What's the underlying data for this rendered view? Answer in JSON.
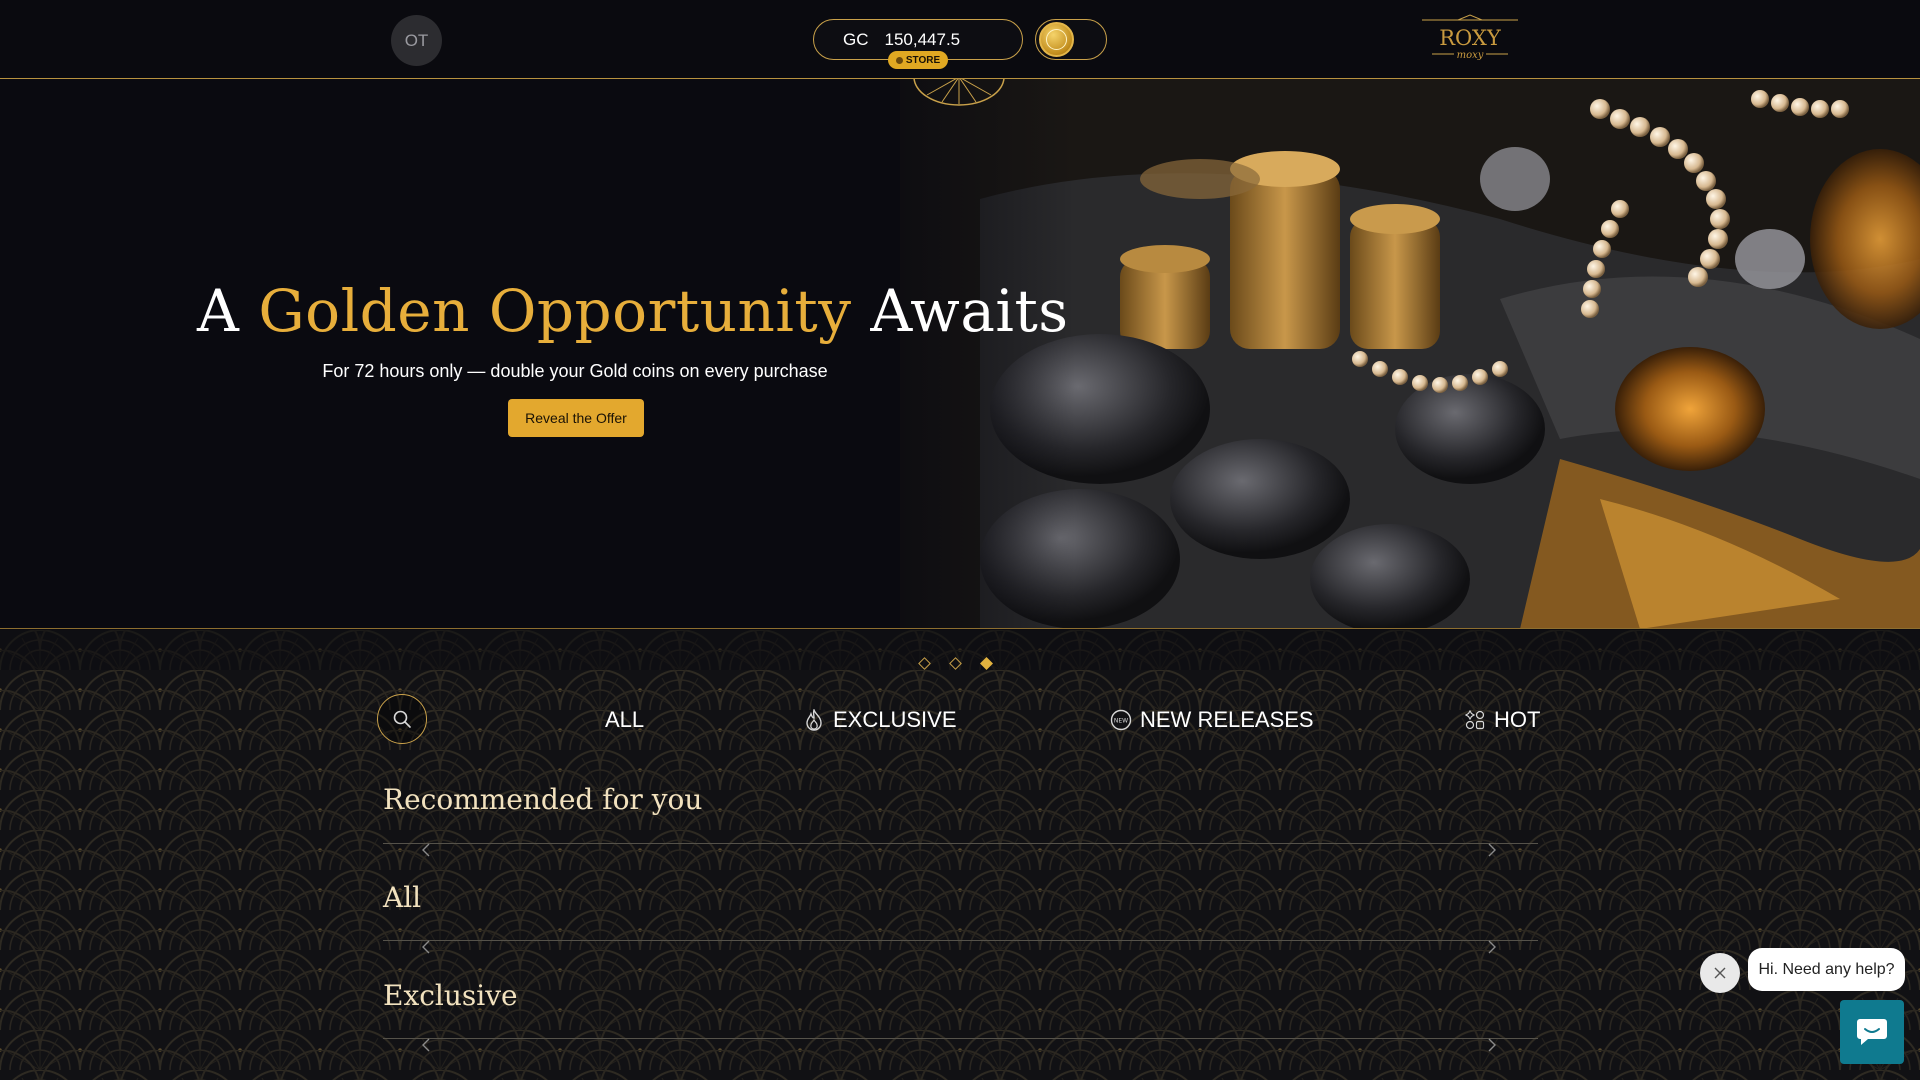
{
  "header": {
    "avatar_initials": "OT",
    "balance": {
      "currency": "GC",
      "amount": "150,447.5"
    },
    "store_label": "STORE",
    "logo": {
      "name": "ROXY",
      "tagline": "moxy"
    }
  },
  "hero": {
    "title_plain_1": "A",
    "title_gold": "Golden Opportunity",
    "title_plain_2": "Awaits",
    "subtitle": "For 72 hours only — double your Gold coins on every purchase",
    "cta_label": "Reveal the Offer"
  },
  "carousel": {
    "slides": 3,
    "active_index": 2
  },
  "tabs": [
    {
      "label": "ALL",
      "icon": "none"
    },
    {
      "label": "EXCLUSIVE",
      "icon": "flame-icon"
    },
    {
      "label": "NEW RELEASES",
      "icon": "new-badge-icon"
    },
    {
      "label": "HOT",
      "icon": "grid-sparkle-icon"
    }
  ],
  "sections": [
    {
      "title": "Recommended for you"
    },
    {
      "title": "All"
    },
    {
      "title": "Exclusive"
    }
  ],
  "chat": {
    "bubble_text": "Hi. Need any help?"
  },
  "colors": {
    "gold": "#e7ae3b",
    "border_gold": "#c9a14a",
    "background": "#0b0b10",
    "chat_button": "#0f7a8f"
  }
}
